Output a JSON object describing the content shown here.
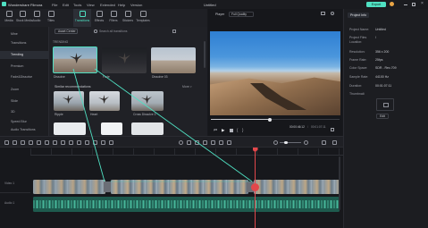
{
  "app": {
    "name": "Wondershare Filmora",
    "project_title": "Untitled",
    "export_label": "Export",
    "menu": [
      "File",
      "Edit",
      "Tools",
      "View",
      "Extended",
      "Help",
      "Version"
    ]
  },
  "toolbar": {
    "items": [
      {
        "label": "Media",
        "icon": "media-icon"
      },
      {
        "label": "Stock Media",
        "icon": "stock-media-icon"
      },
      {
        "label": "Audio",
        "icon": "audio-icon"
      },
      {
        "label": "Titles",
        "icon": "titles-icon"
      },
      {
        "label": "Transitions",
        "icon": "transitions-icon",
        "active": true
      },
      {
        "label": "Effects",
        "icon": "effects-icon"
      },
      {
        "label": "Filters",
        "icon": "filters-icon"
      },
      {
        "label": "Stickers",
        "icon": "stickers-icon"
      },
      {
        "label": "Templates",
        "icon": "templates-icon"
      }
    ]
  },
  "sidebar": {
    "items": [
      {
        "label": "Mine"
      },
      {
        "label": "Transitions"
      },
      {
        "label": "Trending",
        "active": true
      },
      {
        "label": "Premium"
      },
      {
        "label": "Fade&Dissolve"
      },
      {
        "label": "Zoom"
      },
      {
        "label": "Slide"
      },
      {
        "label": "3D"
      },
      {
        "label": "Speed Blur"
      },
      {
        "label": "Audio Transitions"
      }
    ]
  },
  "browser": {
    "source_label": "Asset Center",
    "search_placeholder": "Search all transitions",
    "section_trending": "TRENDING",
    "trending": [
      {
        "label": "Dissolve"
      },
      {
        "label": "Fade"
      },
      {
        "label": "Dissolve 03"
      }
    ],
    "similar_title": "Similar recommendations",
    "similar_more": "More >",
    "similar": [
      {
        "label": "Ripple"
      },
      {
        "label": "Heart"
      },
      {
        "label": "Cross Dissolve 3"
      }
    ]
  },
  "player": {
    "tab_label": "Player",
    "quality": "Full Quality",
    "time_current": "00:00:46:12",
    "time_total": "00:01:07:11"
  },
  "project_info": {
    "tab_label": "Project Info",
    "rows": [
      {
        "key": "Project Name:",
        "value": "Untitled"
      },
      {
        "key": "Project Files Location:",
        "value": "/"
      },
      {
        "key": "Resolution:",
        "value": "356 x 200"
      },
      {
        "key": "Frame Rate:",
        "value": "25fps"
      },
      {
        "key": "Color Space:",
        "value": "SDR - Rec.709"
      },
      {
        "key": "Sample Rate:",
        "value": "44100 Hz"
      },
      {
        "key": "Duration:",
        "value": "00:01:07:11"
      },
      {
        "key": "Thumbnail:",
        "value": ""
      }
    ],
    "edit_label": "Edit"
  },
  "timeline": {
    "tracks": [
      {
        "label": "Video 1"
      },
      {
        "label": "Audio 1"
      }
    ]
  },
  "colors": {
    "accent": "#4fe0c2",
    "playhead": "#e2474b"
  }
}
